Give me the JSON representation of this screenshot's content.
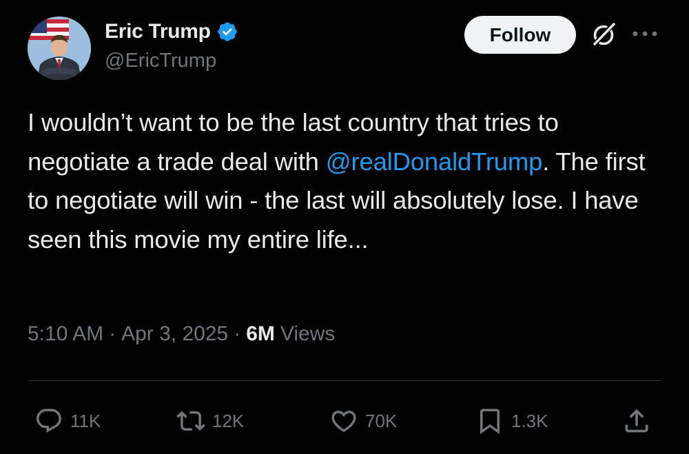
{
  "author": {
    "display_name": "Eric Trump",
    "handle": "@EricTrump",
    "verified": true
  },
  "header": {
    "follow_label": "Follow"
  },
  "tweet": {
    "text_before": "I wouldn’t want to be the last country that tries to negotiate a trade deal with ",
    "mention": "@realDonaldTrump",
    "text_after": ". The first to negotiate will win - the last will absolutely lose. I have seen this movie my entire life..."
  },
  "meta": {
    "time": "5:10 AM",
    "date": "Apr 3, 2025",
    "views_count": "6M",
    "views_label": "Views"
  },
  "actions": {
    "replies": "11K",
    "reposts": "12K",
    "likes": "70K",
    "bookmarks": "1.3K"
  },
  "colors": {
    "background": "#000000",
    "text": "#e7e9ea",
    "secondary": "#71767b",
    "link": "#1d9bf0",
    "verified": "#1d9bf0",
    "divider": "#2f3336",
    "follow_bg": "#eff3f4"
  },
  "icons": {
    "verified": "verified-badge-icon",
    "grok": "grok-icon",
    "more": "more-dots-icon",
    "reply": "reply-icon",
    "repost": "repost-icon",
    "like": "heart-icon",
    "bookmark": "bookmark-icon",
    "share": "share-icon"
  }
}
